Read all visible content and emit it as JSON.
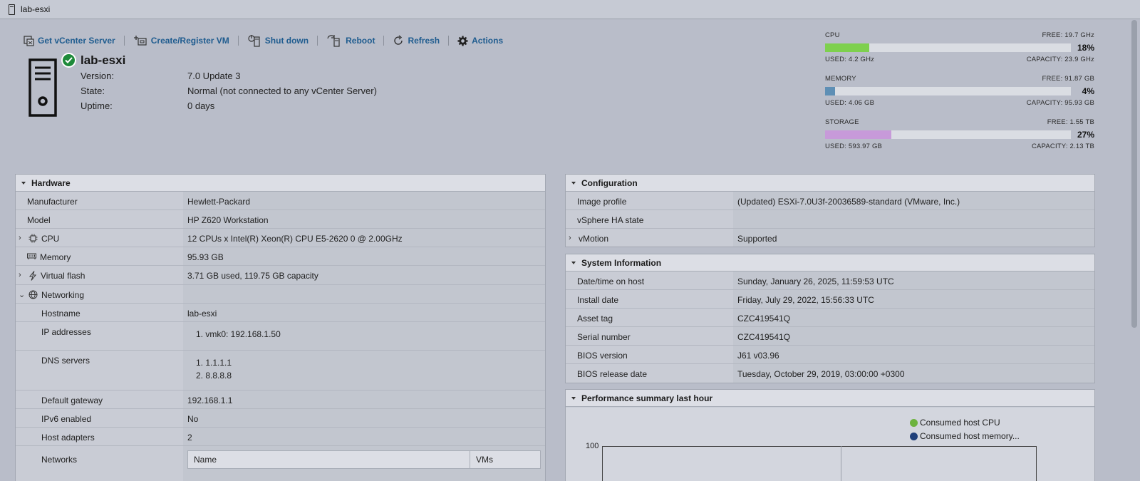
{
  "window": {
    "title": "lab-esxi"
  },
  "toolbar": {
    "get_vcenter": "Get vCenter Server",
    "create_vm": "Create/Register VM",
    "shut_down": "Shut down",
    "reboot": "Reboot",
    "refresh": "Refresh",
    "actions": "Actions"
  },
  "host": {
    "name": "lab-esxi",
    "version_label": "Version:",
    "version": "7.0 Update 3",
    "state_label": "State:",
    "state": "Normal (not connected to any vCenter Server)",
    "uptime_label": "Uptime:",
    "uptime": "0 days"
  },
  "meters": {
    "cpu": {
      "label": "CPU",
      "free": "FREE: 19.7 GHz",
      "pct": "18%",
      "pct_value": 18,
      "used": "USED: 4.2 GHz",
      "capacity": "CAPACITY: 23.9 GHz",
      "color": "#7ed04e"
    },
    "memory": {
      "label": "MEMORY",
      "free": "FREE: 91.87 GB",
      "pct": "4%",
      "pct_value": 4,
      "used": "USED: 4.06 GB",
      "capacity": "CAPACITY: 95.93 GB",
      "color": "#5e8fb5"
    },
    "storage": {
      "label": "STORAGE",
      "free": "FREE: 1.55 TB",
      "pct": "27%",
      "pct_value": 27,
      "used": "USED: 593.97 GB",
      "capacity": "CAPACITY: 2.13 TB",
      "color": "#c79ad9"
    }
  },
  "hardware": {
    "title": "Hardware",
    "manufacturer_label": "Manufacturer",
    "manufacturer": "Hewlett-Packard",
    "model_label": "Model",
    "model": "HP Z620 Workstation",
    "cpu_label": "CPU",
    "cpu": "12 CPUs x Intel(R) Xeon(R) CPU E5-2620 0 @ 2.00GHz",
    "memory_label": "Memory",
    "memory": "95.93 GB",
    "vflash_label": "Virtual flash",
    "vflash": "3.71 GB used, 119.75 GB capacity",
    "networking_label": "Networking",
    "hostname_label": "Hostname",
    "hostname": "lab-esxi",
    "ip_label": "IP addresses",
    "ip_items": [
      "1. vmk0: 192.168.1.50"
    ],
    "dns_label": "DNS servers",
    "dns_items": [
      "1. 1.1.1.1",
      "2. 8.8.8.8"
    ],
    "gateway_label": "Default gateway",
    "gateway": "192.168.1.1",
    "ipv6_label": "IPv6 enabled",
    "ipv6": "No",
    "adapters_label": "Host adapters",
    "adapters": "2",
    "networks_label": "Networks",
    "networks_table": {
      "col_name": "Name",
      "col_vms": "VMs"
    }
  },
  "configuration": {
    "title": "Configuration",
    "image_label": "Image profile",
    "image": "(Updated) ESXi-7.0U3f-20036589-standard (VMware, Inc.)",
    "ha_label": "vSphere HA state",
    "ha": "",
    "vmotion_label": "vMotion",
    "vmotion": "Supported"
  },
  "sysinfo": {
    "title": "System Information",
    "datetime_label": "Date/time on host",
    "datetime": "Sunday, January 26, 2025, 11:59:53 UTC",
    "install_label": "Install date",
    "install": "Friday, July 29, 2022, 15:56:33 UTC",
    "asset_label": "Asset tag",
    "asset": "CZC419541Q",
    "serial_label": "Serial number",
    "serial": "CZC419541Q",
    "bios_label": "BIOS version",
    "bios": "J61 v03.96",
    "bios_date_label": "BIOS release date",
    "bios_date": "Tuesday, October 29, 2019, 03:00:00 +0300"
  },
  "performance": {
    "title": "Performance summary last hour",
    "legend_cpu": "Consumed host CPU",
    "legend_mem": "Consumed host memory...",
    "cpu_color": "#6db33f",
    "mem_color": "#1f3f7a",
    "y_max_label": "100"
  }
}
